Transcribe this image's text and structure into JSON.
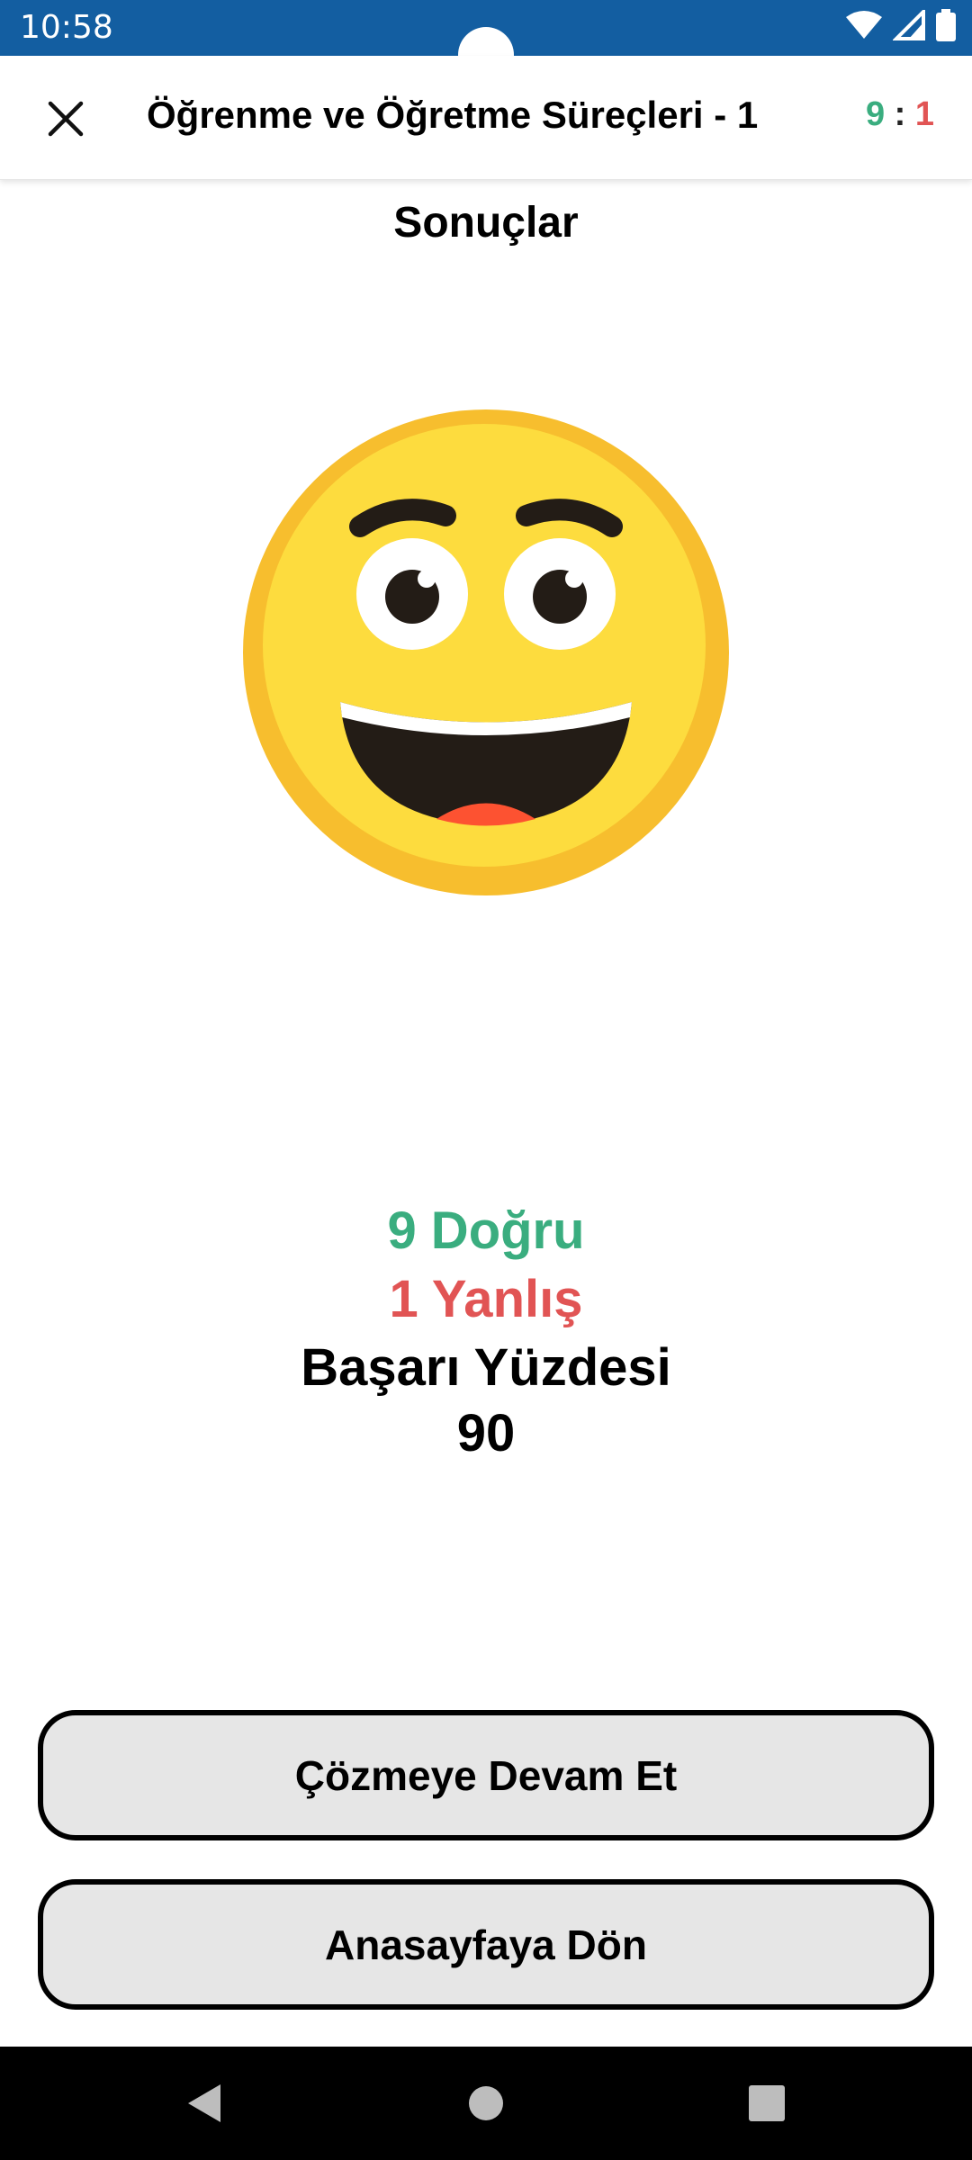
{
  "status_bar": {
    "time": "10:58",
    "background": "#135ea1",
    "icons": [
      "wifi-icon",
      "signal-icon",
      "battery-icon"
    ]
  },
  "app_bar": {
    "close_icon": "close-icon",
    "title": "Öğrenme ve Öğretme Süreçleri - 1",
    "score_correct": "9",
    "score_separator": ":",
    "score_wrong": "1"
  },
  "results": {
    "heading": "Sonuçlar",
    "emoji_icon": "laughing-face-icon",
    "correct_text": "9 Doğru",
    "wrong_text": "1 Yanlış",
    "percentage_label": "Başarı Yüzdesi",
    "percentage_value": "90"
  },
  "buttons": {
    "continue_label": "Çözmeye Devam Et",
    "home_label": "Anasayfaya Dön"
  },
  "nav_bar": {
    "icons": [
      "back-icon",
      "home-icon",
      "recents-icon"
    ]
  },
  "colors": {
    "correct": "#3aad7f",
    "wrong": "#e15454",
    "button_bg": "#e6e6e6",
    "emoji_face": "#fddc3e",
    "emoji_rim": "#f7be2e"
  }
}
